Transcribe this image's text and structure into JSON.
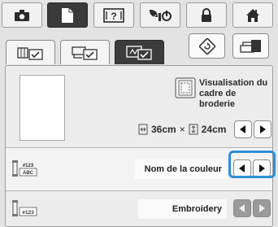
{
  "top_tabs": [
    {
      "name": "camera-icon"
    },
    {
      "name": "document-settings-icon",
      "active": true
    },
    {
      "name": "help-icon"
    },
    {
      "name": "eco-mode-icon"
    },
    {
      "name": "lock-icon"
    },
    {
      "name": "home-icon"
    }
  ],
  "sub_tabs": [
    {
      "name": "sewing-settings-icon"
    },
    {
      "name": "general-settings-icon"
    },
    {
      "name": "embroidery-settings-icon",
      "active": true
    }
  ],
  "right_buttons": [
    {
      "name": "reset-icon"
    },
    {
      "name": "machine-icon"
    }
  ],
  "frame_display": {
    "label": "Visualisation du cadre de broderie",
    "width_value": "36cm",
    "multiply": "×",
    "height_value": "24cm"
  },
  "thread_color": {
    "icon_text": "#123 ABC",
    "value": "Nom de la couleur"
  },
  "thread_number": {
    "icon_text": "#123",
    "value": "Embroidery"
  },
  "colors": {
    "accent": "#2e8fd6",
    "active_tab": "#3a3a3a"
  }
}
